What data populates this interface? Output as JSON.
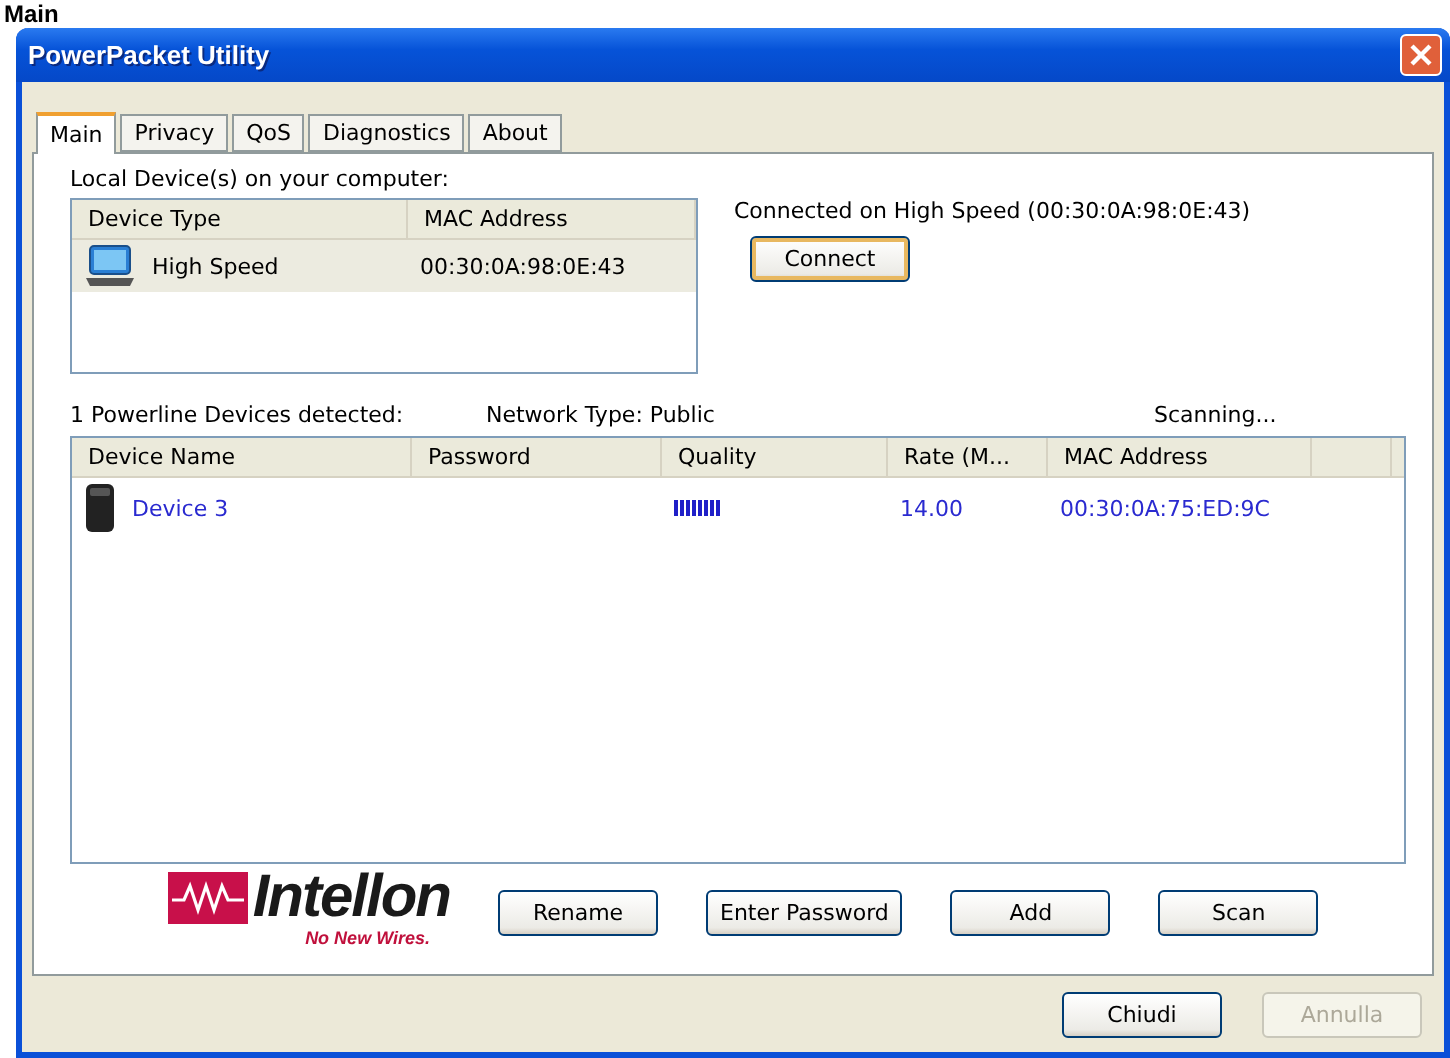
{
  "page_caption": "Main",
  "window": {
    "title": "PowerPacket Utility"
  },
  "tabs": [
    {
      "label": "Main",
      "selected": true
    },
    {
      "label": "Privacy",
      "selected": false
    },
    {
      "label": "QoS",
      "selected": false
    },
    {
      "label": "Diagnostics",
      "selected": false
    },
    {
      "label": "About",
      "selected": false
    }
  ],
  "local_devices": {
    "label": "Local Device(s) on your computer:",
    "columns": [
      "Device Type",
      "MAC Address"
    ],
    "rows": [
      {
        "device_type": "High Speed",
        "mac_address": "00:30:0A:98:0E:43",
        "selected": true
      }
    ]
  },
  "connection": {
    "status": "Connected on  High Speed  (00:30:0A:98:0E:43)",
    "button": "Connect"
  },
  "powerline": {
    "detected": "1 Powerline Devices detected:",
    "network_type": "Network Type: Public",
    "scan_status": "Scanning..."
  },
  "devices_table": {
    "columns": [
      "Device Name",
      "Password",
      "Quality",
      "Rate (M...",
      "MAC Address"
    ],
    "rows": [
      {
        "device_name": "Device 3",
        "password": "",
        "rate": "14.00",
        "mac_address": "00:30:0A:75:ED:9C"
      }
    ]
  },
  "logo": {
    "name": "Intellon",
    "tagline": "No New Wires."
  },
  "actions": [
    "Rename",
    "Enter Password",
    "Add",
    "Scan"
  ],
  "dialog_buttons": [
    {
      "label": "Chiudi",
      "disabled": false
    },
    {
      "label": "Annulla",
      "disabled": true
    }
  ]
}
